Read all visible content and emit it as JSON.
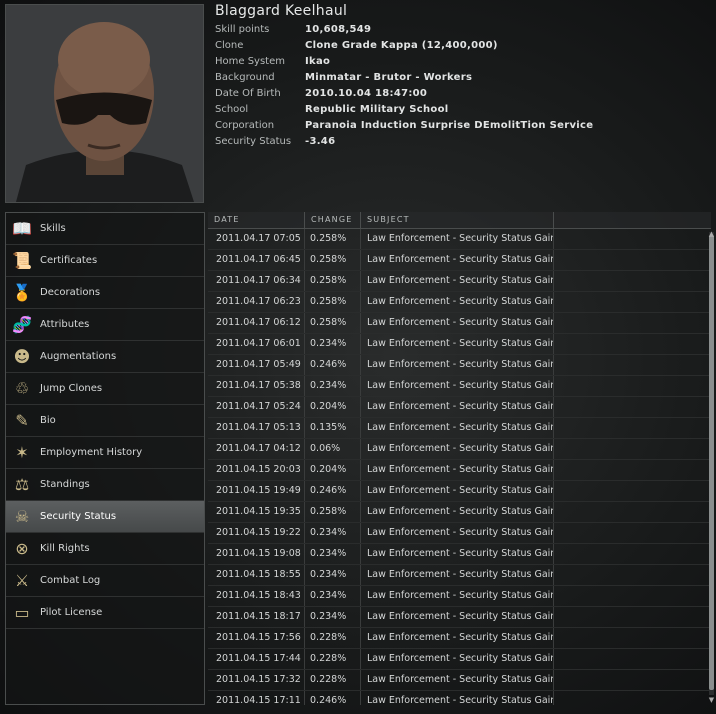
{
  "character": {
    "name": "Blaggard Keelhaul",
    "fields": [
      {
        "label": "Skill points",
        "value": "10,608,549"
      },
      {
        "label": "Clone",
        "value": "Clone Grade Kappa (12,400,000)"
      },
      {
        "label": "Home System",
        "value": "Ikao"
      },
      {
        "label": "Background",
        "value": "Minmatar - Brutor - Workers"
      },
      {
        "label": "Date Of Birth",
        "value": "2010.10.04 18:47:00"
      },
      {
        "label": "School",
        "value": "Republic Military School"
      },
      {
        "label": "Corporation",
        "value": "Paranoia Induction Surprise DEmolitTion Service"
      },
      {
        "label": "Security Status",
        "value": "-3.46"
      }
    ]
  },
  "sidebar": {
    "active": "Security Status",
    "items": [
      {
        "label": "Skills",
        "icon": "book-icon"
      },
      {
        "label": "Certificates",
        "icon": "certificate-icon"
      },
      {
        "label": "Decorations",
        "icon": "medal-icon"
      },
      {
        "label": "Attributes",
        "icon": "dna-icon"
      },
      {
        "label": "Augmentations",
        "icon": "implant-head-icon"
      },
      {
        "label": "Jump Clones",
        "icon": "clone-icon"
      },
      {
        "label": "Bio",
        "icon": "notepad-icon"
      },
      {
        "label": "Employment History",
        "icon": "people-star-icon"
      },
      {
        "label": "Standings",
        "icon": "standings-icon"
      },
      {
        "label": "Security Status",
        "icon": "skull-icon"
      },
      {
        "label": "Kill Rights",
        "icon": "killrights-icon"
      },
      {
        "label": "Combat Log",
        "icon": "crossed-swords-icon"
      },
      {
        "label": "Pilot License",
        "icon": "license-card-icon"
      }
    ]
  },
  "table": {
    "columns": [
      "DATE",
      "CHANGE",
      "SUBJECT"
    ],
    "rows": [
      {
        "date": "2011.04.17 07:05",
        "change": "0.258%",
        "subject": "Law Enforcement - Security Status Gain"
      },
      {
        "date": "2011.04.17 06:45",
        "change": "0.258%",
        "subject": "Law Enforcement - Security Status Gain"
      },
      {
        "date": "2011.04.17 06:34",
        "change": "0.258%",
        "subject": "Law Enforcement - Security Status Gain"
      },
      {
        "date": "2011.04.17 06:23",
        "change": "0.258%",
        "subject": "Law Enforcement - Security Status Gain"
      },
      {
        "date": "2011.04.17 06:12",
        "change": "0.258%",
        "subject": "Law Enforcement - Security Status Gain"
      },
      {
        "date": "2011.04.17 06:01",
        "change": "0.234%",
        "subject": "Law Enforcement - Security Status Gain"
      },
      {
        "date": "2011.04.17 05:49",
        "change": "0.246%",
        "subject": "Law Enforcement - Security Status Gain"
      },
      {
        "date": "2011.04.17 05:38",
        "change": "0.234%",
        "subject": "Law Enforcement - Security Status Gain"
      },
      {
        "date": "2011.04.17 05:24",
        "change": "0.204%",
        "subject": "Law Enforcement - Security Status Gain"
      },
      {
        "date": "2011.04.17 05:13",
        "change": "0.135%",
        "subject": "Law Enforcement - Security Status Gain"
      },
      {
        "date": "2011.04.17 04:12",
        "change": "0.06%",
        "subject": "Law Enforcement - Security Status Gain"
      },
      {
        "date": "2011.04.15 20:03",
        "change": "0.204%",
        "subject": "Law Enforcement - Security Status Gain"
      },
      {
        "date": "2011.04.15 19:49",
        "change": "0.246%",
        "subject": "Law Enforcement - Security Status Gain"
      },
      {
        "date": "2011.04.15 19:35",
        "change": "0.258%",
        "subject": "Law Enforcement - Security Status Gain"
      },
      {
        "date": "2011.04.15 19:22",
        "change": "0.234%",
        "subject": "Law Enforcement - Security Status Gain"
      },
      {
        "date": "2011.04.15 19:08",
        "change": "0.234%",
        "subject": "Law Enforcement - Security Status Gain"
      },
      {
        "date": "2011.04.15 18:55",
        "change": "0.234%",
        "subject": "Law Enforcement - Security Status Gain"
      },
      {
        "date": "2011.04.15 18:43",
        "change": "0.234%",
        "subject": "Law Enforcement - Security Status Gain"
      },
      {
        "date": "2011.04.15 18:17",
        "change": "0.234%",
        "subject": "Law Enforcement - Security Status Gain"
      },
      {
        "date": "2011.04.15 17:56",
        "change": "0.228%",
        "subject": "Law Enforcement - Security Status Gain"
      },
      {
        "date": "2011.04.15 17:44",
        "change": "0.228%",
        "subject": "Law Enforcement - Security Status Gain"
      },
      {
        "date": "2011.04.15 17:32",
        "change": "0.228%",
        "subject": "Law Enforcement - Security Status Gain"
      },
      {
        "date": "2011.04.15 17:11",
        "change": "0.246%",
        "subject": "Law Enforcement - Security Status Gain"
      }
    ]
  }
}
